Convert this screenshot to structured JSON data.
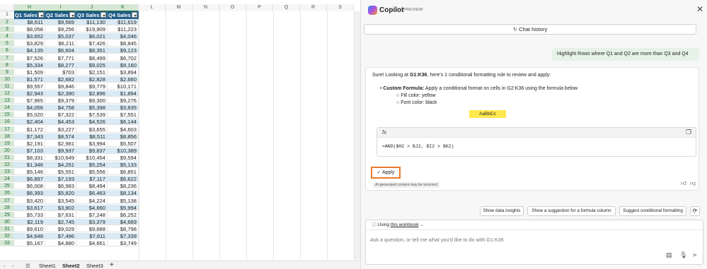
{
  "sheet": {
    "column_letters": [
      "H",
      "I",
      "J",
      "K",
      "L",
      "M",
      "N",
      "O",
      "P",
      "Q",
      "R",
      "S"
    ],
    "headers": [
      "Q1 Sales",
      "Q2 Sales",
      "Q3 Sales",
      "Q4 Sales"
    ],
    "row_numbers": [
      "1",
      "2",
      "3",
      "4",
      "5",
      "6",
      "7",
      "8",
      "9",
      "10",
      "11",
      "12",
      "13",
      "14",
      "15",
      "16",
      "17",
      "18",
      "19",
      "20",
      "21",
      "22",
      "23",
      "24",
      "25",
      "26",
      "27",
      "28",
      "29",
      "30",
      "31",
      "32",
      "33"
    ],
    "rows": [
      [
        "$8,611",
        "$9,569",
        "$11,130",
        "$11,619"
      ],
      [
        "$8,058",
        "$9,256",
        "$19,909",
        "$11,223"
      ],
      [
        "$3,652",
        "$5,037",
        "$6,021",
        "$4,046"
      ],
      [
        "$3,829",
        "$6,211",
        "$7,426",
        "$8,845"
      ],
      [
        "$4,135",
        "$6,604",
        "$8,351",
        "$9,123"
      ],
      [
        "$7,526",
        "$7,771",
        "$8,499",
        "$6,702"
      ],
      [
        "$5,334",
        "$8,277",
        "$9,025",
        "$9,160"
      ],
      [
        "$1,509",
        "$703",
        "$2,151",
        "$3,894"
      ],
      [
        "$1,571",
        "$2,682",
        "$2,828",
        "$2,660"
      ],
      [
        "$9,557",
        "$9,846",
        "$9,779",
        "$10,171"
      ],
      [
        "$2,943",
        "$2,390",
        "$2,896",
        "$1,894"
      ],
      [
        "$7,965",
        "$9,379",
        "$9,300",
        "$9,276"
      ],
      [
        "$4,056",
        "$4,758",
        "$5,398",
        "$3,835"
      ],
      [
        "$5,020",
        "$7,322",
        "$7,539",
        "$7,551"
      ],
      [
        "$2,404",
        "$4,453",
        "$4,526",
        "$6,144"
      ],
      [
        "$1,172",
        "$3,227",
        "$3,655",
        "$4,603"
      ],
      [
        "$7,343",
        "$8,574",
        "$8,511",
        "$8,856"
      ],
      [
        "$2,191",
        "$2,981",
        "$3,994",
        "$5,507"
      ],
      [
        "$7,103",
        "$9,937",
        "$9,837",
        "$10,389"
      ],
      [
        "$8,331",
        "$10,649",
        "$10,454",
        "$9,594"
      ],
      [
        "$1,346",
        "$4,251",
        "$5,254",
        "$5,133"
      ],
      [
        "$5,146",
        "$5,551",
        "$5,556",
        "$6,851"
      ],
      [
        "$6,897",
        "$7,193",
        "$7,117",
        "$6,622"
      ],
      [
        "$6,008",
        "$6,983",
        "$8,494",
        "$8,236"
      ],
      [
        "$6,393",
        "$5,820",
        "$6,463",
        "$8,134"
      ],
      [
        "$3,420",
        "$3,545",
        "$4,224",
        "$5,138"
      ],
      [
        "$3,617",
        "$3,902",
        "$4,660",
        "$5,994"
      ],
      [
        "$5,733",
        "$7,631",
        "$7,248",
        "$6,252"
      ],
      [
        "$2,119",
        "$2,745",
        "$3,379",
        "$4,669"
      ],
      [
        "$9,610",
        "$9,029",
        "$9,688",
        "$8,798"
      ],
      [
        "$4,648",
        "$7,496",
        "$7,811",
        "$7,339"
      ],
      [
        "$5,167",
        "$4,880",
        "$4,661",
        "$3,749"
      ]
    ],
    "sheet_tabs": [
      "Sheet1",
      "Sheet2",
      "Sheet3"
    ],
    "active_tab": "Sheet2",
    "add_sheet": "+",
    "colors": {
      "header_bg": "#1f5c86",
      "band": "#d9eaf5",
      "selected_header": "#d6e7d6",
      "tab_active": "#217346"
    }
  },
  "copilot": {
    "title": "Copilot",
    "badge": "PREVIEW",
    "chat_history": "Chat history",
    "user_message": "Highlight Rows where Q1 and Q2 are more than Q3 and Q4",
    "reply_prefix": "Sure! Looking at ",
    "reply_range": "G1:K36",
    "reply_suffix": ", here's 1 conditional formatting rule to review and apply:",
    "custom_formula_label": "Custom Formula:",
    "custom_formula_text": " Apply a conditional format on cells in G2:K36 using the formula below",
    "fill_color": "Fill color: yellow",
    "font_color": "Font color: black",
    "preview_sample": "AaBbCc",
    "fx_label": "fx",
    "formula": "=AND($H2 > $J2, $I2 > $K2)",
    "apply_label": "Apply",
    "disclaimer": "AI-generated content may be incorrect",
    "suggestions": [
      "Show data insights",
      "Show a suggestion for a formula column",
      "Suggest conditional formatting"
    ],
    "using_prefix": "Using ",
    "using_link": "this workbook",
    "input_placeholder": "Ask a question, or tell me what you'd like to do with G1:K36",
    "colors": {
      "accent_orange": "#e97b2e",
      "preview_yellow": "#ffe84d",
      "user_bubble": "#e6f2e6"
    }
  }
}
